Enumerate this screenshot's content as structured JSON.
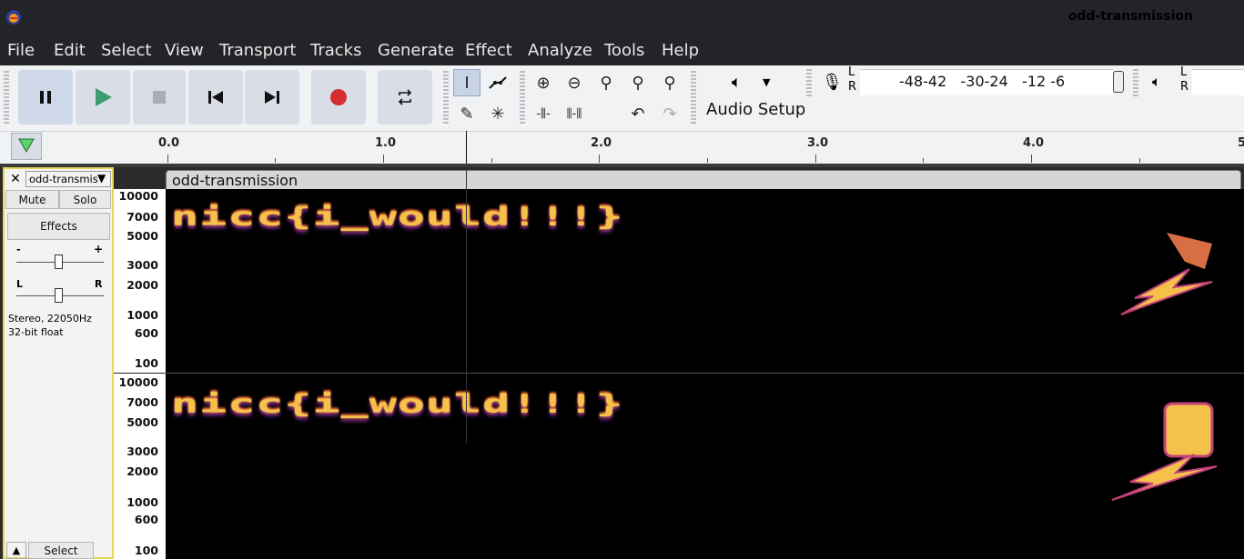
{
  "window": {
    "title": "odd-transmission"
  },
  "menu": [
    "File",
    "Edit",
    "Select",
    "View",
    "Transport",
    "Tracks",
    "Generate",
    "Effect",
    "Analyze",
    "Tools",
    "Help"
  ],
  "toolbar": {
    "audio_setup_label": "Audio Setup",
    "meter_lr": [
      "L",
      "R"
    ],
    "meter_scale": "-48-42   -30-24   -12 -6"
  },
  "timeline": {
    "labels": [
      "0.0",
      "1.0",
      "2.0",
      "3.0",
      "4.0",
      "5"
    ]
  },
  "track": {
    "name": "odd-transmis",
    "mute_label": "Mute",
    "solo_label": "Solo",
    "effects_label": "Effects",
    "gain_minus": "-",
    "gain_plus": "+",
    "pan_left": "L",
    "pan_right": "R",
    "info_line1": "Stereo, 22050Hz",
    "info_line2": "32-bit float",
    "select_label": "Select",
    "close_symbol": "✕"
  },
  "clip": {
    "title": "odd-transmission"
  },
  "ruler": {
    "channel1": [
      "10000",
      "7000",
      "5000",
      "3000",
      "2000",
      "1000",
      "600",
      "100"
    ],
    "channel2": [
      "10000",
      "7000",
      "5000",
      "3000",
      "2000",
      "1000",
      "600",
      "100"
    ]
  },
  "spectrogram": {
    "channel1_text": "nicc{i_would!!!}",
    "channel2_text": "nicc{i_would!!!}"
  },
  "colors": {
    "accent_record": "#d32f2f",
    "play_green": "#3f9c6e",
    "track_selected_border": "#e6d655"
  }
}
